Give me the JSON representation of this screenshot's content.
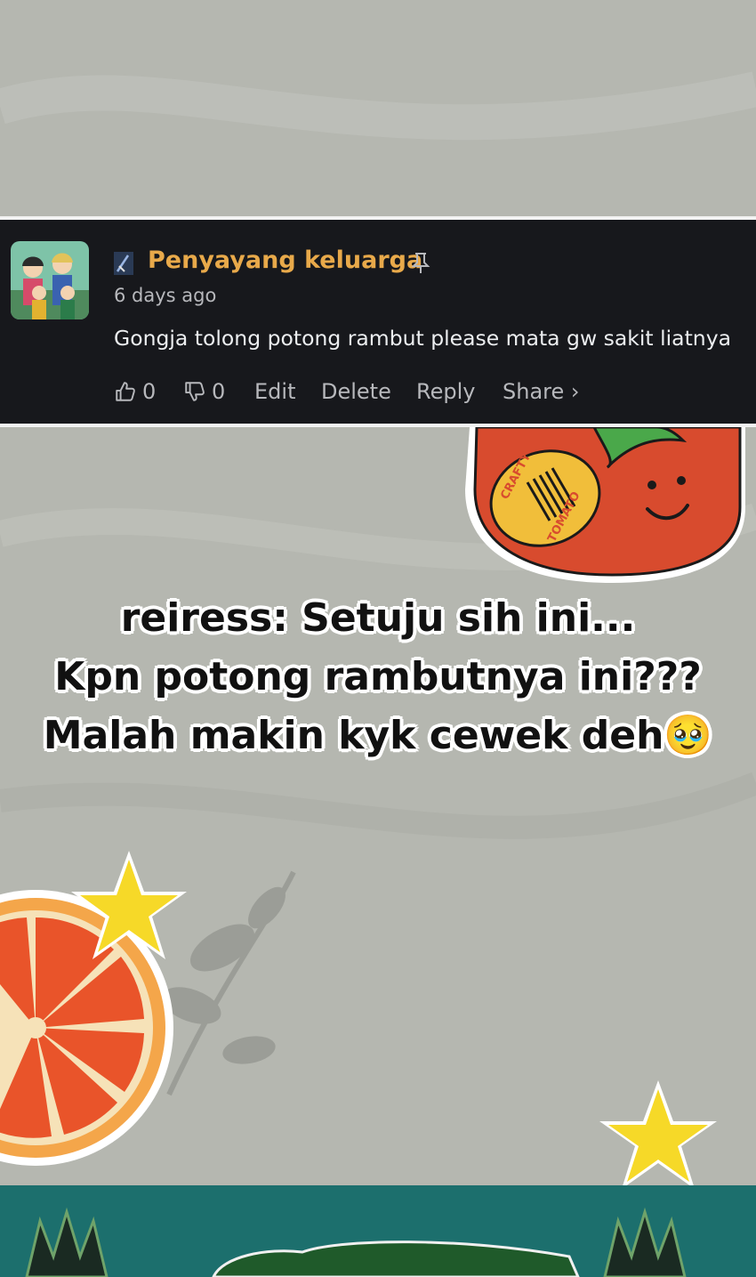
{
  "comment": {
    "username": "Penyayang keluarga",
    "timestamp": "6 days ago",
    "text": "Gongja tolong potong rambut please mata gw sakit liatnya",
    "likes": "0",
    "dislikes": "0",
    "edit_label": "Edit",
    "delete_label": "Delete",
    "reply_label": "Reply",
    "share_label": "Share ›"
  },
  "sticker": {
    "tomato_text": [
      "CRAFTY",
      "TOMATO"
    ]
  },
  "caption": {
    "line1": "reiress: Setuju sih ini...",
    "line2": "Kpn potong rambutnya ini???",
    "line3": "Malah makin kyk cewek deh🥹"
  },
  "colors": {
    "background": "#b5b7b0",
    "comment_bg": "#17181c",
    "username": "#e8a94a",
    "footer": "#1c6f6d"
  }
}
